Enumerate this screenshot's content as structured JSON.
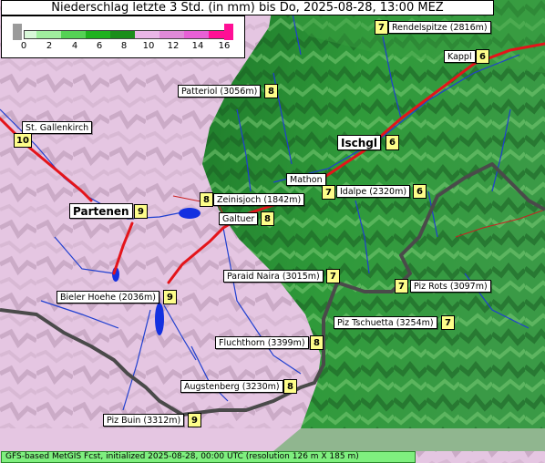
{
  "title": "Niederschlag letzte 3 Std. (in mm) bis Do, 2025-08-28, 13:00 MEZ",
  "legend": {
    "ticks": [
      "0",
      "2",
      "4",
      "6",
      "8",
      "10",
      "12",
      "14",
      "16"
    ],
    "colors": [
      "#d8f7d8",
      "#a0ee9e",
      "#55d255",
      "#1fb21f",
      "#1a8e1a",
      "#e9b6e6",
      "#e08ad8",
      "#e860d6",
      "#ff0f95"
    ]
  },
  "places": [
    {
      "name": "Rendelspitze (2816m)",
      "value": "7"
    },
    {
      "name": "Kappl",
      "value": "6"
    },
    {
      "name": "Patteriol (3056m)",
      "value": "8"
    },
    {
      "name": "St. Gallenkirch",
      "value": "10"
    },
    {
      "name": "Ischgl",
      "value": "6"
    },
    {
      "name": "Mathon",
      "value": "7"
    },
    {
      "name": "Idalpe (2320m)",
      "value": "6"
    },
    {
      "name": "Zeinisjoch (1842m)",
      "value": "8"
    },
    {
      "name": "Partenen",
      "value": "9"
    },
    {
      "name": "Galtuer",
      "value": "8"
    },
    {
      "name": "Paraid Naira (3015m)",
      "value": "7"
    },
    {
      "name": "Piz Rots (3097m)",
      "value": "7"
    },
    {
      "name": "Bieler Hoehe (2036m)",
      "value": "9"
    },
    {
      "name": "Piz Tschuetta (3254m)",
      "value": "7"
    },
    {
      "name": "Fluchthorn (3399m)",
      "value": "8"
    },
    {
      "name": "Augstenberg (3230m)",
      "value": "8"
    },
    {
      "name": "Piz Buin (3312m)",
      "value": "9"
    }
  ],
  "footer": "GFS-based MetGIS Fcst, initialized 2025-08-28, 00:00 UTC  (resolution 126 m X 185 m)"
}
